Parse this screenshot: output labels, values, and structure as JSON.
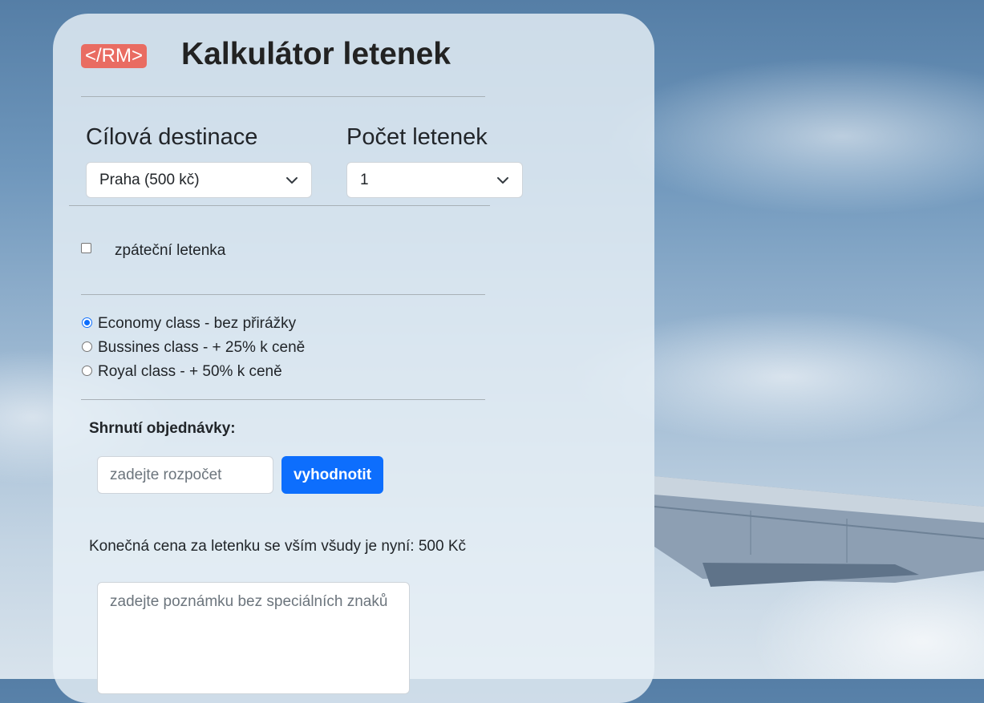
{
  "header": {
    "logo_text": "</RM>",
    "title": "Kalkulátor letenek"
  },
  "destination": {
    "label": "Cílová destinace",
    "selected": "Praha (500 kč)"
  },
  "tickets": {
    "label": "Počet letenek",
    "selected": "1"
  },
  "return_ticket": {
    "label": "zpáteční letenka",
    "checked": false
  },
  "classes": [
    {
      "label": "Economy class - bez přirážky",
      "checked": true
    },
    {
      "label": "Bussines class - + 25% k ceně",
      "checked": false
    },
    {
      "label": "Royal class - + 50% k ceně",
      "checked": false
    }
  ],
  "summary": {
    "heading": "Shrnutí objednávky:",
    "budget_placeholder": "zadejte rozpočet",
    "evaluate_button": "vyhodnotit",
    "final_price_text": "Konečná cena za letenku se vším všudy je nyní: 500 Kč",
    "note_placeholder": "zadejte poznámku bez speciálních znaků"
  },
  "colors": {
    "accent": "#0d6efd",
    "logo_bg": "#e96c62"
  },
  "icons": [
    "chevron-down-icon",
    "airplane-wing-image"
  ]
}
